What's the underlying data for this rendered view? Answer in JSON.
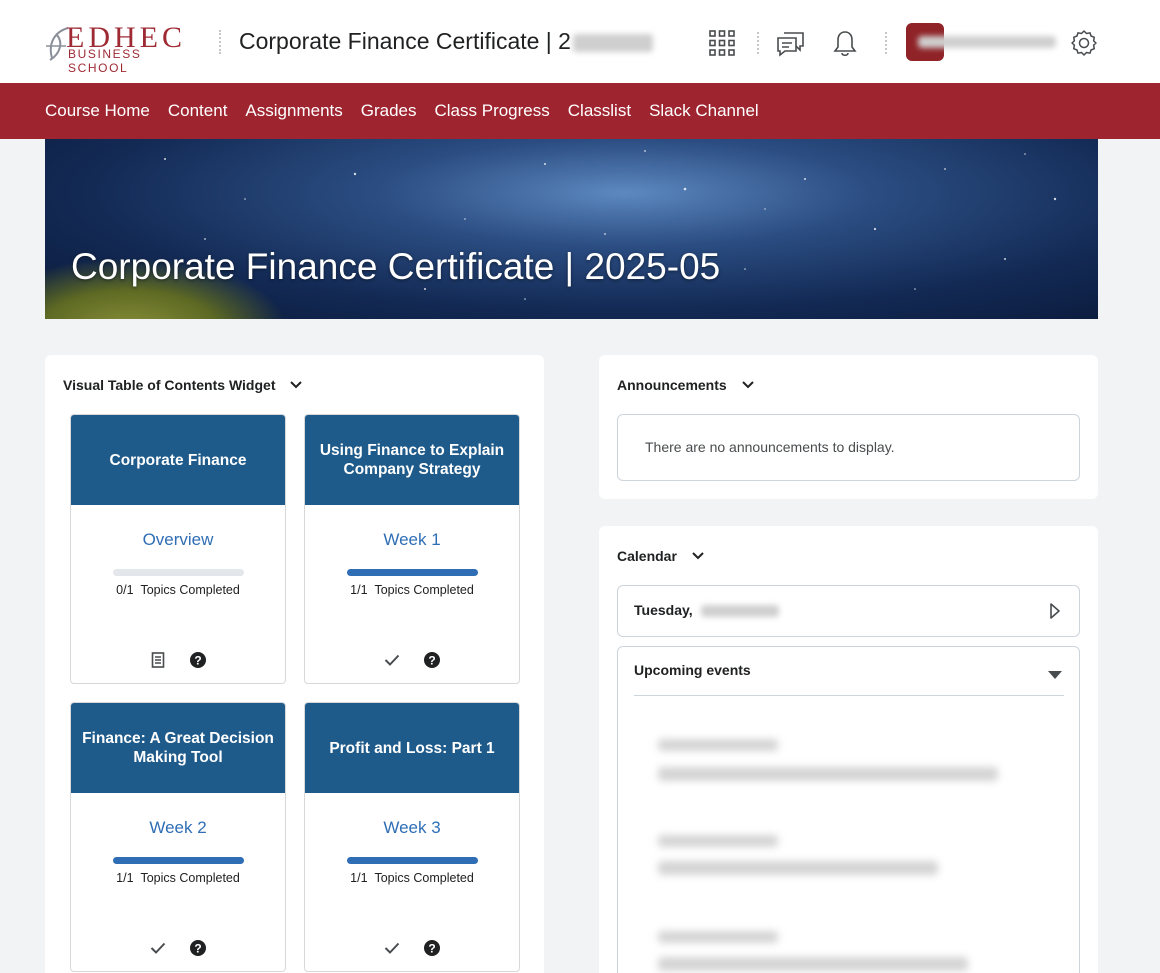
{
  "header": {
    "logo_top": "EDHEC",
    "logo_bottom": "BUSINESS SCHOOL",
    "course_title": "Corporate Finance Certificate | 2",
    "icons": [
      "apps-grid-icon",
      "chat-icon",
      "bell-icon",
      "gear-icon"
    ]
  },
  "nav": {
    "items": [
      "Course Home",
      "Content",
      "Assignments",
      "Grades",
      "Class Progress",
      "Classlist",
      "Slack Channel"
    ]
  },
  "banner": {
    "title": "Corporate Finance Certificate | 2025-05"
  },
  "toc_widget": {
    "title": "Visual Table of Contents Widget",
    "tiles": [
      {
        "heading": "Corporate Finance",
        "link": "Overview",
        "completed": "0/1",
        "label": "Topics Completed",
        "progress": 0.0,
        "icons": [
          "document-icon",
          "help-icon"
        ]
      },
      {
        "heading": "Using Finance to Explain Company Strategy",
        "link": "Week 1",
        "completed": "1/1",
        "label": "Topics Completed",
        "progress": 1.0,
        "icons": [
          "check-icon",
          "help-icon"
        ]
      },
      {
        "heading": "Finance: A Great Decision Making Tool",
        "link": "Week 2",
        "completed": "1/1",
        "label": "Topics Completed",
        "progress": 1.0,
        "icons": [
          "check-icon",
          "help-icon"
        ]
      },
      {
        "heading": "Profit and Loss: Part 1",
        "link": "Week 3",
        "completed": "1/1",
        "label": "Topics Completed",
        "progress": 1.0,
        "icons": [
          "check-icon",
          "help-icon"
        ]
      }
    ]
  },
  "announcements": {
    "title": "Announcements",
    "empty_message": "There are no announcements to display."
  },
  "calendar": {
    "title": "Calendar",
    "day_label": "Tuesday,",
    "upcoming_label": "Upcoming events"
  },
  "colors": {
    "nav_bg": "#9e2430",
    "tile_head": "#1e5a8a",
    "link": "#2f6eb5",
    "brand": "#9e2a34"
  }
}
